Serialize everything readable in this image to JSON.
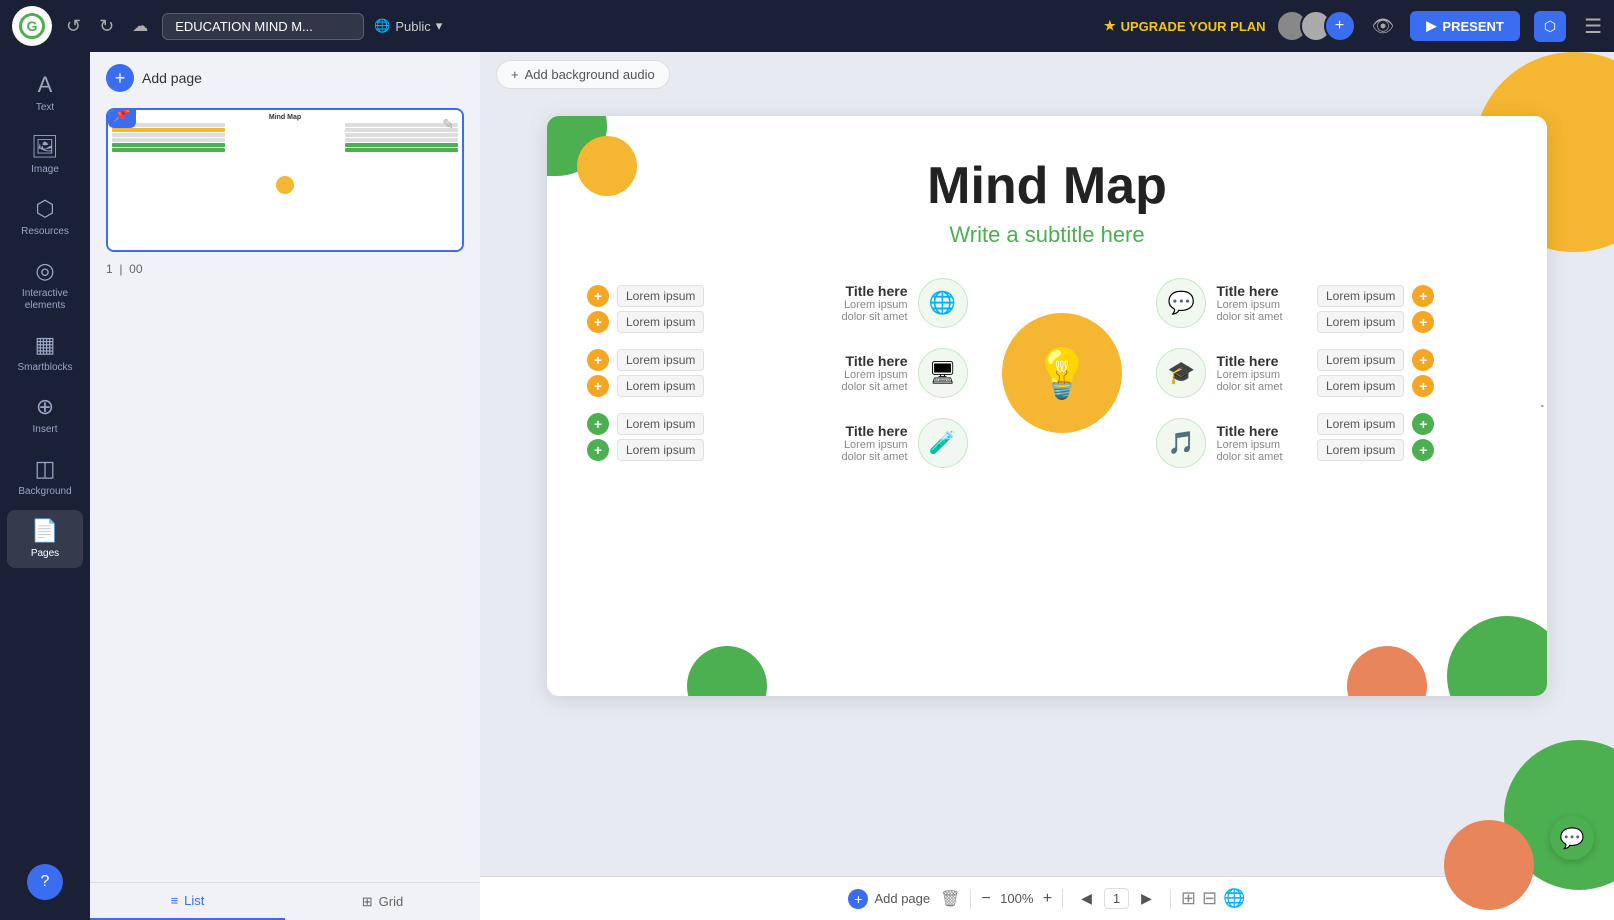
{
  "topbar": {
    "undo_label": "↺",
    "redo_label": "↻",
    "doc_name": "EDUCATION MIND M...",
    "visibility": "Public",
    "upgrade_label": "UPGRADE YOUR PLAN",
    "present_label": "PRESENT",
    "share_label": "⬡"
  },
  "sidebar": {
    "items": [
      {
        "id": "text",
        "icon": "A",
        "label": "Text"
      },
      {
        "id": "image",
        "icon": "🖼",
        "label": "Image"
      },
      {
        "id": "resources",
        "icon": "⬡",
        "label": "Resources"
      },
      {
        "id": "interactive",
        "icon": "◎",
        "label": "Interactive elements"
      },
      {
        "id": "smartblocks",
        "icon": "▦",
        "label": "Smartblocks"
      },
      {
        "id": "insert",
        "icon": "⊕",
        "label": "Insert"
      },
      {
        "id": "background",
        "icon": "◫",
        "label": "Background"
      },
      {
        "id": "pages",
        "icon": "📄",
        "label": "Pages"
      }
    ]
  },
  "panel": {
    "add_page_label": "Add page",
    "slide_number": "1",
    "slide_time": "00",
    "tabs": [
      {
        "id": "list",
        "label": "List",
        "icon": "≡"
      },
      {
        "id": "grid",
        "label": "Grid",
        "icon": "⊞"
      }
    ]
  },
  "canvas": {
    "audio_btn": "Add background audio",
    "slide": {
      "title": "Mind Map",
      "subtitle": "Write a subtitle here",
      "left_items": [
        {
          "type": "orange",
          "text": "Lorem ipsum"
        },
        {
          "type": "orange",
          "text": "Lorem ipsum"
        },
        {
          "type": "orange",
          "text": "Lorem ipsum"
        },
        {
          "type": "orange",
          "text": "Lorem ipsum"
        },
        {
          "type": "green",
          "text": "Lorem ipsum"
        },
        {
          "type": "green",
          "text": "Lorem ipsum"
        }
      ],
      "branches": [
        {
          "title": "Title here",
          "desc": "Lorem ipsum dolor sit amet",
          "icon": "🌐",
          "row": 0
        },
        {
          "title": "Title here",
          "desc": "Lorem ipsum dolor sit amet",
          "icon": "🖥",
          "row": 1
        },
        {
          "title": "Title here",
          "desc": "Lorem ipsum dolor sit amet",
          "icon": "🧪",
          "row": 2
        }
      ],
      "right_branches": [
        {
          "title": "Title here",
          "desc": "Lorem ipsum dolor sit amet",
          "icon": "💬",
          "items": [
            {
              "type": "orange",
              "text": "Lorem ipsum"
            },
            {
              "type": "orange",
              "text": "Lorem ipsum"
            }
          ]
        },
        {
          "title": "Title here",
          "desc": "Lorem ipsum dolor sit amet",
          "icon": "🎓",
          "items": [
            {
              "type": "orange",
              "text": "Lorem ipsum"
            },
            {
              "type": "orange",
              "text": "Lorem ipsum"
            }
          ]
        },
        {
          "title": "Title here",
          "desc": "Lorem ipsum dolor sit amet",
          "icon": "🎵",
          "items": [
            {
              "type": "green",
              "text": "Lorem ipsum"
            },
            {
              "type": "green",
              "text": "Lorem ipsum"
            }
          ]
        }
      ]
    },
    "bottombar": {
      "add_page": "Add page",
      "zoom": "100%",
      "page_current": "1"
    }
  }
}
